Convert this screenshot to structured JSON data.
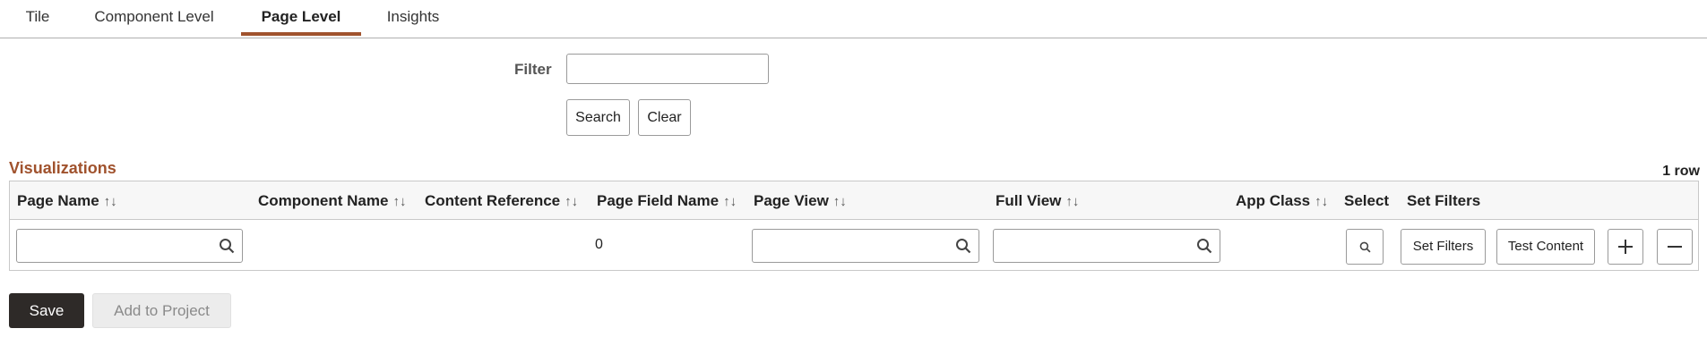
{
  "tabs": [
    {
      "label": "Tile"
    },
    {
      "label": "Component Level"
    },
    {
      "label": "Page Level",
      "active": true
    },
    {
      "label": "Insights"
    }
  ],
  "filter": {
    "label": "Filter",
    "value": "",
    "search_label": "Search",
    "clear_label": "Clear"
  },
  "grid": {
    "title": "Visualizations",
    "row_count": "1 row",
    "columns": {
      "page_name": "Page Name",
      "component_name": "Component Name",
      "content_reference": "Content Reference",
      "page_field_name": "Page Field Name",
      "page_view": "Page View",
      "full_view": "Full View",
      "app_class": "App Class",
      "select": "Select",
      "set_filters": "Set Filters"
    },
    "sort_glyph": "↑↓",
    "row": {
      "page_name": "",
      "page_field_name_value": "0",
      "page_view": "",
      "full_view": "",
      "set_filters_button": "Set Filters",
      "test_content_button": "Test Content"
    }
  },
  "actions": {
    "save_label": "Save",
    "add_to_project_label": "Add to Project"
  },
  "colors": {
    "accent": "#a0522d",
    "save_bg": "#2e2a28"
  }
}
